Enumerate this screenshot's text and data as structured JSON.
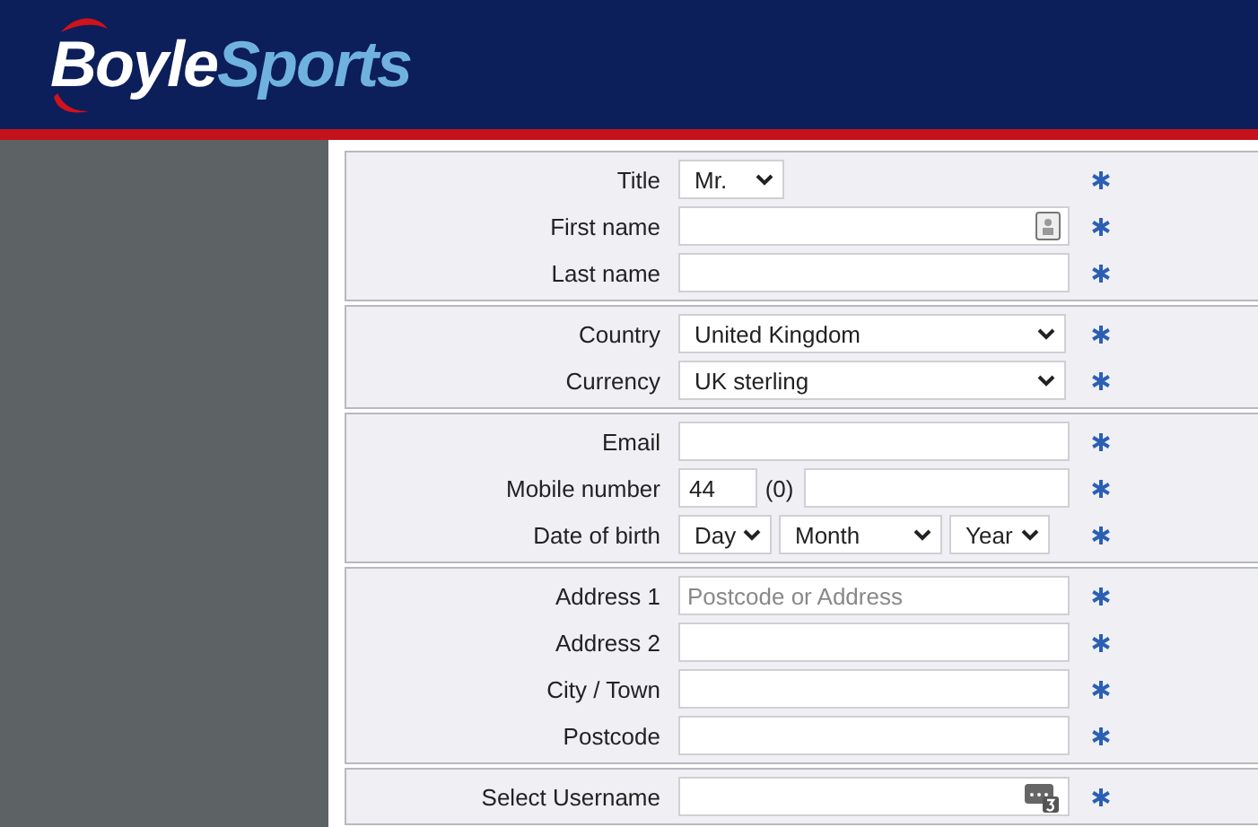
{
  "logo": {
    "primary": "Boyle",
    "secondary": "Sports"
  },
  "sections": [
    {
      "fields": [
        {
          "label": "Title",
          "kind": "choice",
          "value": "Mr.",
          "required": true
        },
        {
          "label": "First name",
          "kind": "contact",
          "required": true
        },
        {
          "label": "Last name",
          "kind": "text",
          "required": true
        }
      ]
    },
    {
      "fields": [
        {
          "label": "Country",
          "kind": "select",
          "value": "United Kingdom",
          "required": true
        },
        {
          "label": "Currency",
          "kind": "select",
          "value": "UK sterling",
          "required": true
        }
      ]
    },
    {
      "fields": [
        {
          "label": "Email",
          "kind": "text",
          "required": true
        },
        {
          "label": "Mobile number",
          "kind": "phone",
          "code": "44",
          "trunk": "(0)",
          "required": true
        },
        {
          "label": "Date of birth",
          "kind": "date",
          "parts": [
            "Day",
            "Month",
            "Year"
          ],
          "required": true
        }
      ]
    },
    {
      "fields": [
        {
          "label": "Address 1",
          "kind": "text",
          "placeholder": "Postcode or Address",
          "required": true
        },
        {
          "label": "Address 2",
          "kind": "text",
          "required": true
        },
        {
          "label": "City / Town",
          "kind": "text",
          "required": true
        },
        {
          "label": "Postcode",
          "kind": "text",
          "required": true
        }
      ]
    },
    {
      "fields": [
        {
          "label": "Select Username",
          "kind": "username",
          "required": true
        }
      ]
    }
  ]
}
